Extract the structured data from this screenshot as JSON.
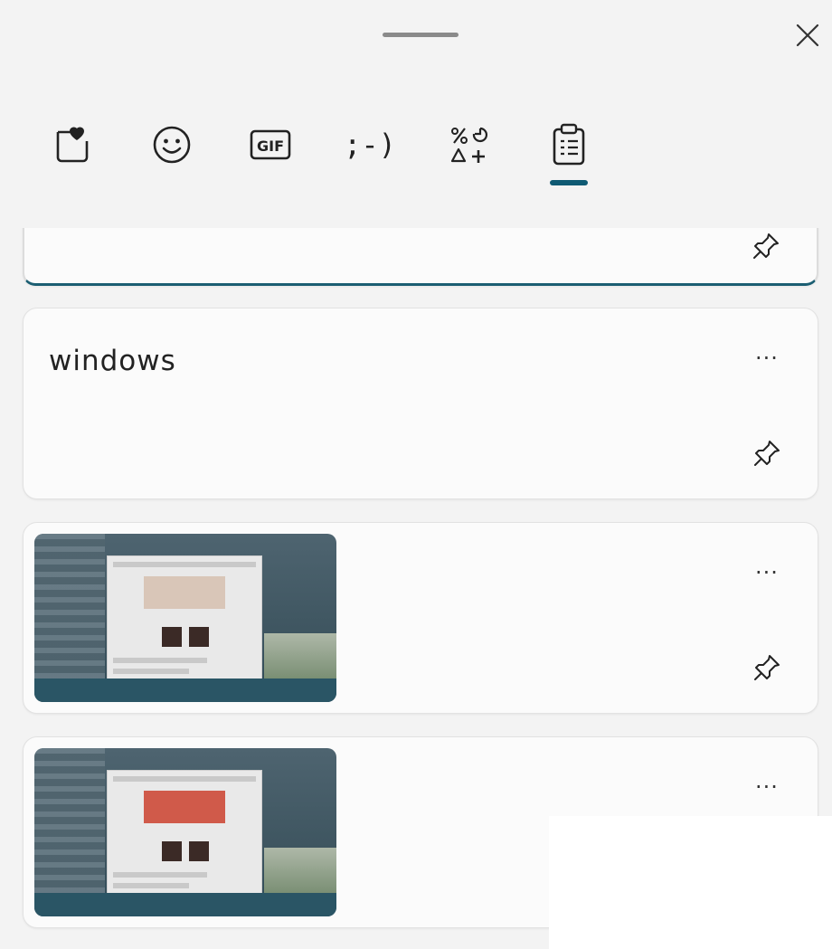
{
  "tabs": [
    {
      "name": "favorites",
      "icon": "heart-sticker-icon",
      "label": ""
    },
    {
      "name": "emoji",
      "icon": "smiley-icon",
      "label": ""
    },
    {
      "name": "gif",
      "icon": "gif-icon",
      "label": "GIF"
    },
    {
      "name": "kaomoji",
      "icon": "kaomoji-icon",
      "label": ";-)"
    },
    {
      "name": "symbols",
      "icon": "symbols-icon",
      "label": ""
    },
    {
      "name": "clipboard",
      "icon": "clipboard-icon",
      "label": "",
      "active": true
    }
  ],
  "clipboard_items": [
    {
      "type": "text",
      "text": "",
      "selected": true
    },
    {
      "type": "text",
      "text": "windows"
    },
    {
      "type": "image",
      "variant": "light"
    },
    {
      "type": "image",
      "variant": "red"
    }
  ],
  "more_label": "···",
  "colors": {
    "accent": "#0f5a73",
    "background": "#f3f3f3",
    "card": "#fbfbfb"
  }
}
